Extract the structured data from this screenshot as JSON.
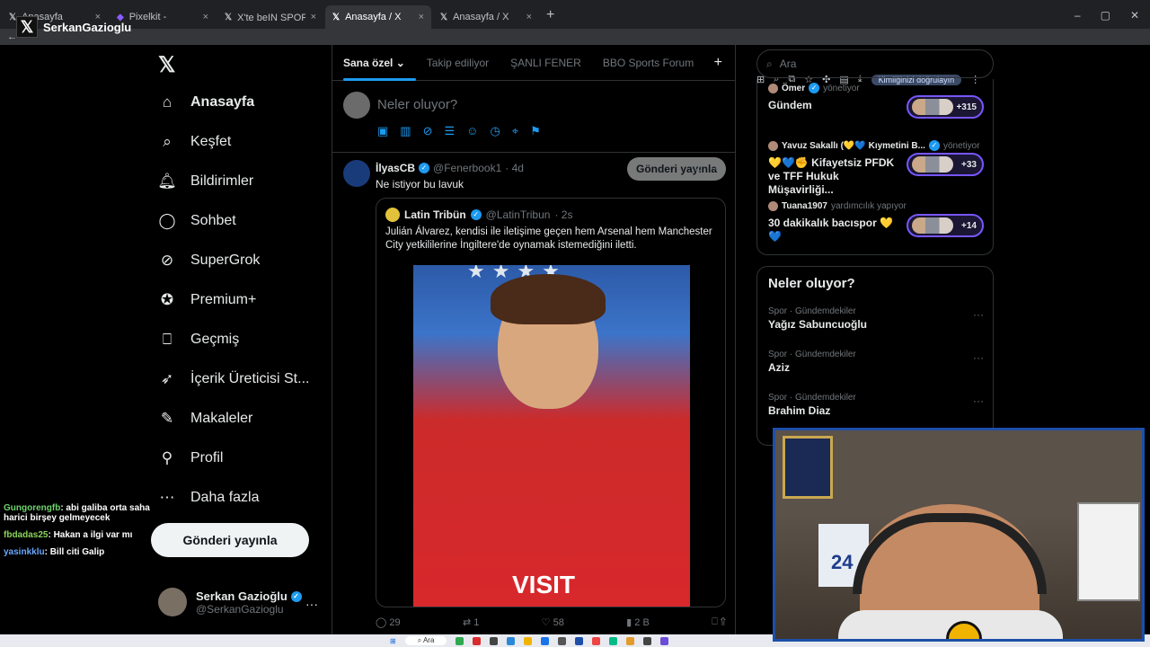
{
  "browser": {
    "tabs": [
      {
        "label": "Anasayfa",
        "icon": "x-logo-icon"
      },
      {
        "label": "Pixelkit -",
        "icon": "pixelkit-icon"
      },
      {
        "label": "X'te beIN SPORTS Türkiye: \"😀 ...",
        "icon": "x-logo-icon"
      },
      {
        "label": "Anasayfa / X",
        "icon": "x-logo-icon"
      },
      {
        "label": "Anasayfa / X",
        "icon": "x-logo-icon"
      }
    ],
    "new_tab": "+",
    "verify_label": "Kimliğinizi doğrulayın"
  },
  "overlay": {
    "streamer_name": "SerkanGazioglu"
  },
  "nav": {
    "items": [
      {
        "label": "Anasayfa",
        "icon": "home-icon"
      },
      {
        "label": "Keşfet",
        "icon": "search-icon"
      },
      {
        "label": "Bildirimler",
        "icon": "bell-icon"
      },
      {
        "label": "Sohbet",
        "icon": "chat-icon"
      },
      {
        "label": "SuperGrok",
        "icon": "grok-icon"
      },
      {
        "label": "Premium+",
        "icon": "premium-icon"
      },
      {
        "label": "Geçmiş",
        "icon": "bookmark-icon"
      },
      {
        "label": "İçerik Üreticisi St...",
        "icon": "rocket-icon"
      },
      {
        "label": "Makaleler",
        "icon": "article-icon"
      },
      {
        "label": "Profil",
        "icon": "person-icon"
      },
      {
        "label": "Daha fazla",
        "icon": "more-circle-icon"
      }
    ],
    "post_button": "Gönderi yayınla",
    "account": {
      "name": "Serkan Gazioğlu",
      "handle": "@SerkanGazioglu"
    }
  },
  "chat": [
    {
      "user": "Gungorengfb",
      "text": ": abi galiba orta saha harici birşey gelmeyecek"
    },
    {
      "user": "fbdadas25",
      "text": ": Hakan a ilgi var mı"
    },
    {
      "user": "yasinkklu",
      "text": ": Bill citi Galip"
    }
  ],
  "timeline": {
    "tabs": [
      "Sana özel",
      "Takip ediliyor",
      "ŞANLI FENER",
      "BBO Sports Forum"
    ],
    "compose_placeholder": "Neler oluyor?",
    "post_button": "Gönderi yayınla",
    "tweet": {
      "name": "İlyasCB",
      "handle": "@Fenerbook1",
      "time": "· 4d",
      "text": "Ne istiyor bu lavuk",
      "quote": {
        "name": "Latin Tribün",
        "handle": "@LatinTribun",
        "time": "· 2s",
        "text": "Julián Álvarez, kendisi ile iletişime geçen hem Arsenal hem Manchester City yetkililerine İngiltere'de oynamak istemediğini iletti.",
        "photo_text": "VISIT"
      },
      "metrics": {
        "replies": "29",
        "reposts": "1",
        "likes": "58",
        "views": "2 B"
      }
    }
  },
  "right": {
    "search_placeholder": "Ara",
    "spaces": [
      {
        "host": "Ömer",
        "role": "yönetiyor",
        "title": "Gündem",
        "count": "+315"
      },
      {
        "host": "Yavuz Sakallı (💛💙 Kıymetini B...",
        "role": "yönetiyor",
        "title": "💛💙✊ Kifayetsiz PFDK ve TFF Hukuk Müşavirliği...",
        "count": "+33"
      },
      {
        "host": "Tuana1907",
        "role": "yardımcılık yapıyor",
        "title": "30 dakikalık bacıspor 💛💙",
        "count": "+14"
      }
    ],
    "trends_title": "Neler oluyor?",
    "trends": [
      {
        "category": "Spor · Gündemdekiler",
        "name": "Yağız Sabuncuoğlu"
      },
      {
        "category": "Spor · Gündemdekiler",
        "name": "Aziz"
      },
      {
        "category": "Spor · Gündemdekiler",
        "name": "Brahim Diaz"
      }
    ]
  },
  "webcam": {
    "jersey_number": "24"
  },
  "taskbar": {
    "search_label": "Ara"
  }
}
